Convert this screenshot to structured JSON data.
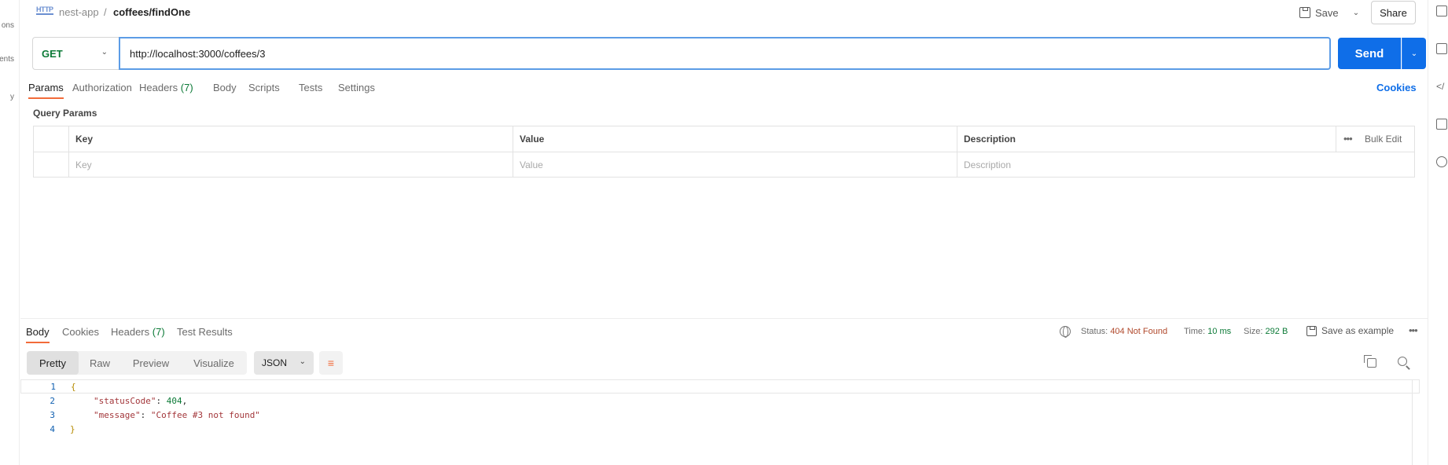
{
  "sidebar_left": {
    "fragments": [
      "ons",
      "ents",
      "y"
    ]
  },
  "header": {
    "breadcrumb_parent": "nest-app",
    "breadcrumb_sep": "/",
    "breadcrumb_current": "coffees/findOne",
    "http_badge": "HTTP",
    "save_label": "Save",
    "share_label": "Share"
  },
  "request": {
    "method": "GET",
    "url": "http://localhost:3000/coffees/3",
    "send_label": "Send",
    "tabs": [
      {
        "label": "Params",
        "count": ""
      },
      {
        "label": "Authorization",
        "count": ""
      },
      {
        "label": "Headers",
        "count": "(7)"
      },
      {
        "label": "Body",
        "count": ""
      },
      {
        "label": "Scripts",
        "count": ""
      },
      {
        "label": "Tests",
        "count": ""
      },
      {
        "label": "Settings",
        "count": ""
      }
    ],
    "active_tab": "Params",
    "cookies_label": "Cookies"
  },
  "query_params": {
    "title": "Query Params",
    "headers": {
      "key": "Key",
      "value": "Value",
      "description": "Description"
    },
    "bulk_edit_label": "Bulk Edit",
    "placeholders": {
      "key": "Key",
      "value": "Value",
      "description": "Description"
    }
  },
  "response": {
    "tabs": [
      {
        "label": "Body",
        "count": ""
      },
      {
        "label": "Cookies",
        "count": ""
      },
      {
        "label": "Headers",
        "count": "(7)"
      },
      {
        "label": "Test Results",
        "count": ""
      }
    ],
    "active_tab": "Body",
    "status_label": "Status:",
    "status_value": "404 Not Found",
    "time_label": "Time:",
    "time_value": "10 ms",
    "size_label": "Size:",
    "size_value": "292 B",
    "save_example_label": "Save as example",
    "view_modes": [
      "Pretty",
      "Raw",
      "Preview",
      "Visualize"
    ],
    "active_view": "Pretty",
    "format": "JSON",
    "body_lines": [
      {
        "num": "1",
        "text": "{"
      },
      {
        "num": "2",
        "key": "\"statusCode\"",
        "value": "404",
        "trail": ","
      },
      {
        "num": "3",
        "key": "\"message\"",
        "value": "\"Coffee #3 not found\"",
        "trail": ""
      },
      {
        "num": "4",
        "text": "}"
      }
    ]
  },
  "colors": {
    "accent": "#0f6ee8",
    "method_get": "#0c7a37",
    "status_error": "#b0482b",
    "tab_underline": "#f26b3a"
  }
}
